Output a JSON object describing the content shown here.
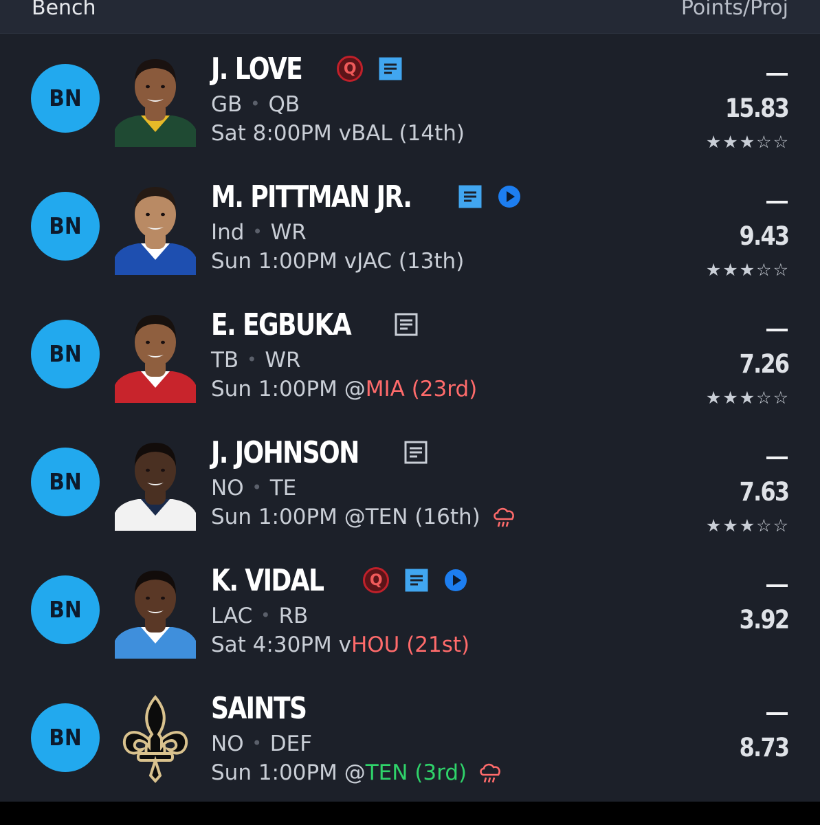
{
  "header": {
    "left": "Bench",
    "right": "Points/Proj"
  },
  "colors": {
    "bg": "#1c2029",
    "badge": "#22a9ee",
    "red": "#ff6b6b",
    "green": "#2fd36a",
    "note": "#41a6f0",
    "play": "#1d7ef0"
  },
  "players": [
    {
      "slot": "BN",
      "name": "J. LOVE",
      "team": "GB",
      "pos": "QB",
      "game_pre": "Sat 8:00PM v ",
      "opp": "BAL (14th)",
      "opp_color": "normal",
      "score": "—",
      "proj": "15.83",
      "stars": 3,
      "q": true,
      "note": "blue",
      "play": false,
      "weather": false
    },
    {
      "slot": "BN",
      "name": "M. PITTMAN JR.",
      "team": "Ind",
      "pos": "WR",
      "game_pre": "Sun 1:00PM v ",
      "opp": "JAC (13th)",
      "opp_color": "normal",
      "score": "—",
      "proj": "9.43",
      "stars": 3,
      "q": false,
      "note": "blue",
      "play": true,
      "weather": false
    },
    {
      "slot": "BN",
      "name": "E. EGBUKA",
      "team": "TB",
      "pos": "WR",
      "game_pre": "Sun 1:00PM @ ",
      "opp": "MIA (23rd)",
      "opp_color": "red",
      "score": "—",
      "proj": "7.26",
      "stars": 3,
      "q": false,
      "note": "gray",
      "play": false,
      "weather": false
    },
    {
      "slot": "BN",
      "name": "J. JOHNSON",
      "team": "NO",
      "pos": "TE",
      "game_pre": "Sun 1:00PM @ ",
      "opp": "TEN (16th)",
      "opp_color": "normal",
      "score": "—",
      "proj": "7.63",
      "stars": 3,
      "q": false,
      "note": "gray",
      "play": false,
      "weather": true
    },
    {
      "slot": "BN",
      "name": "K. VIDAL",
      "team": "LAC",
      "pos": "RB",
      "game_pre": "Sat 4:30PM v ",
      "opp": "HOU (21st)",
      "opp_color": "red",
      "score": "—",
      "proj": "3.92",
      "stars": 0,
      "q": true,
      "note": "blue",
      "play": true,
      "weather": false
    },
    {
      "slot": "BN",
      "name": "SAINTS",
      "team": "NO",
      "pos": "DEF",
      "game_pre": "Sun 1:00PM @ ",
      "opp": "TEN (3rd)",
      "opp_color": "green",
      "score": "—",
      "proj": "8.73",
      "stars": 0,
      "q": false,
      "note": "none",
      "play": false,
      "weather": true
    }
  ],
  "labels": {
    "dot": "•",
    "q": "Q"
  }
}
